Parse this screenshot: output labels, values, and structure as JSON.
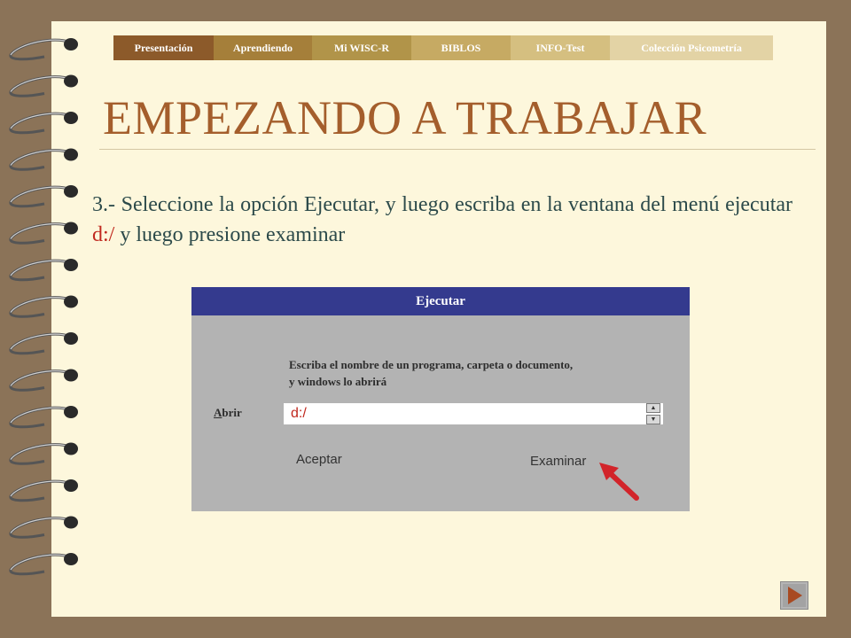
{
  "nav": {
    "tabs": [
      {
        "label": "Presentación",
        "bg": "#8c5a2a",
        "width": 113
      },
      {
        "label": "Aprendiendo",
        "bg": "#a57f3a",
        "width": 111
      },
      {
        "label": "Mi WISC-R",
        "bg": "#b19449",
        "width": 112
      },
      {
        "label": "BIBLOS",
        "bg": "#c6aa63",
        "width": 112
      },
      {
        "label": "INFO-Test",
        "bg": "#d5bf80",
        "width": 112
      },
      {
        "label": "Colección Psicometría",
        "bg": "#e3d3a5",
        "width": 184
      }
    ]
  },
  "slide": {
    "title": "EMPEZANDO A TRABAJAR",
    "instruction_before": "3.- Seleccione la opción Ejecutar, y luego escriba en la ventana del menú ejecutar ",
    "instruction_path": "d:/",
    "instruction_after": " y luego presione examinar"
  },
  "dialog": {
    "title": "Ejecutar",
    "description_line1": "Escriba el nombre de un programa, carpeta o documento,",
    "description_line2": "y windows lo abrirá",
    "open_label_underlined": "A",
    "open_label_rest": "brir",
    "open_value": "d:/",
    "ok_label": "Aceptar",
    "browse_label": "Examinar"
  },
  "icons": {
    "pointer_arrow": "red-arrow-icon",
    "next": "next-slide-icon",
    "spin_up": "spin-up-icon",
    "spin_down": "spin-down-icon"
  },
  "colors": {
    "background": "#8b7358",
    "page": "#fdf7dc",
    "title": "#a45e2c",
    "dialog_title": "#343a8e",
    "dialog_body": "#b3b3b3",
    "highlight": "#c0281e"
  }
}
